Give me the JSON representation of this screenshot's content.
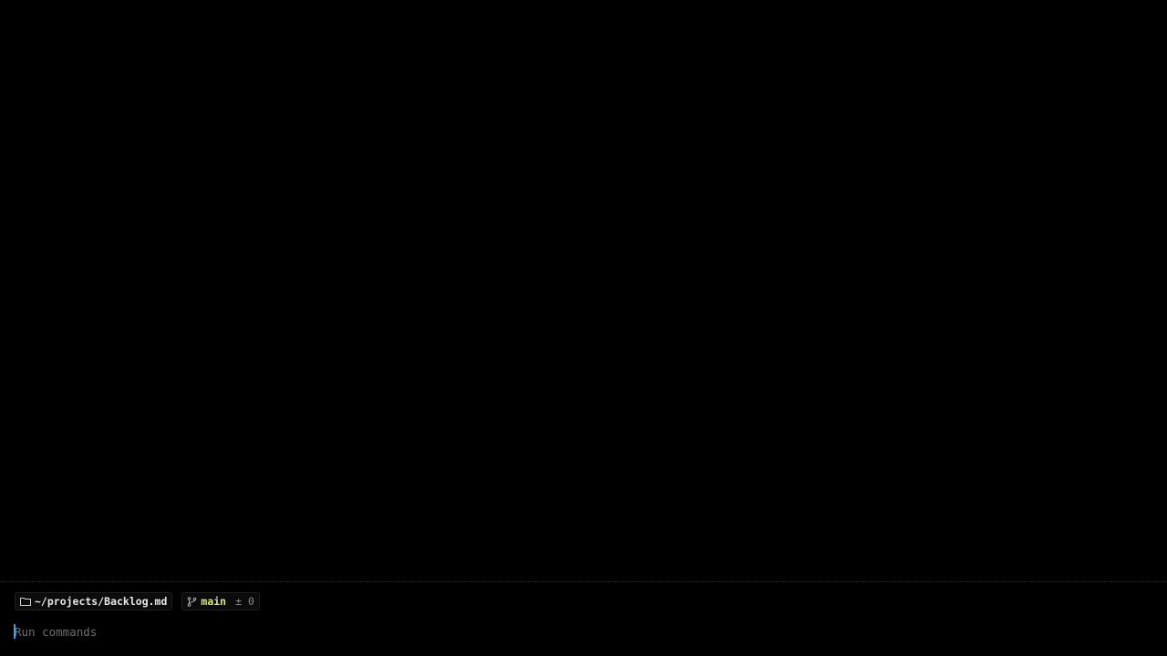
{
  "status_bar": {
    "directory": {
      "icon": "folder-icon",
      "path": "~/projects/Backlog.md"
    },
    "git": {
      "icon": "git-branch-icon",
      "branch": "main",
      "diff": "± 0",
      "branch_color": "#d7e57a"
    }
  },
  "command_input": {
    "value": "",
    "placeholder": "Run commands",
    "cursor_color": "#3aa0ff"
  }
}
